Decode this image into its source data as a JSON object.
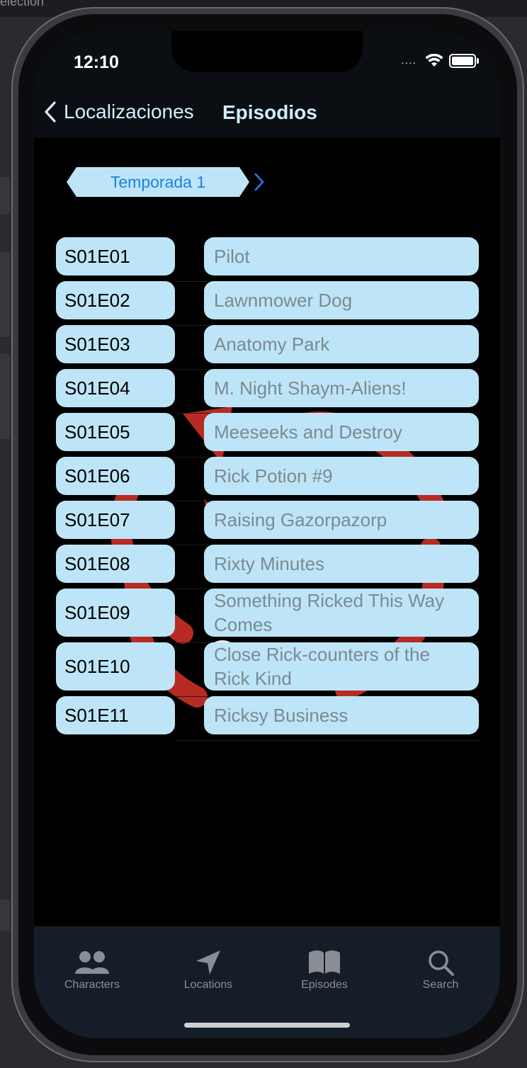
{
  "background": {
    "window_title": "election"
  },
  "status_bar": {
    "time": "12:10",
    "signal": "...."
  },
  "nav": {
    "back_label": "Localizaciones",
    "title": "Episodios"
  },
  "season": {
    "label": "Temporada 1"
  },
  "episodes": [
    {
      "code": "S01E01",
      "name": "Pilot"
    },
    {
      "code": "S01E02",
      "name": "Lawnmower Dog"
    },
    {
      "code": "S01E03",
      "name": "Anatomy Park"
    },
    {
      "code": "S01E04",
      "name": "M. Night Shaym-Aliens!"
    },
    {
      "code": "S01E05",
      "name": "Meeseeks and Destroy"
    },
    {
      "code": "S01E06",
      "name": "Rick Potion #9"
    },
    {
      "code": "S01E07",
      "name": "Raising Gazorpazorp"
    },
    {
      "code": "S01E08",
      "name": "Rixty Minutes"
    },
    {
      "code": "S01E09",
      "name": "Something Ricked This Way Comes"
    },
    {
      "code": "S01E10",
      "name": "Close Rick-counters of the Rick Kind"
    },
    {
      "code": "S01E11",
      "name": "Ricksy Business"
    }
  ],
  "tabbar": {
    "items": [
      {
        "label": "Characters",
        "icon": "people-icon"
      },
      {
        "label": "Locations",
        "icon": "location-arrow-icon"
      },
      {
        "label": "Episodes",
        "icon": "book-icon"
      },
      {
        "label": "Search",
        "icon": "search-icon"
      }
    ]
  },
  "colors": {
    "pill": "#bde5f7",
    "accent": "#1f7fe6",
    "header": "#0b0f14",
    "tabbar": "#141d28",
    "backdrop_red": "#b82a24"
  }
}
